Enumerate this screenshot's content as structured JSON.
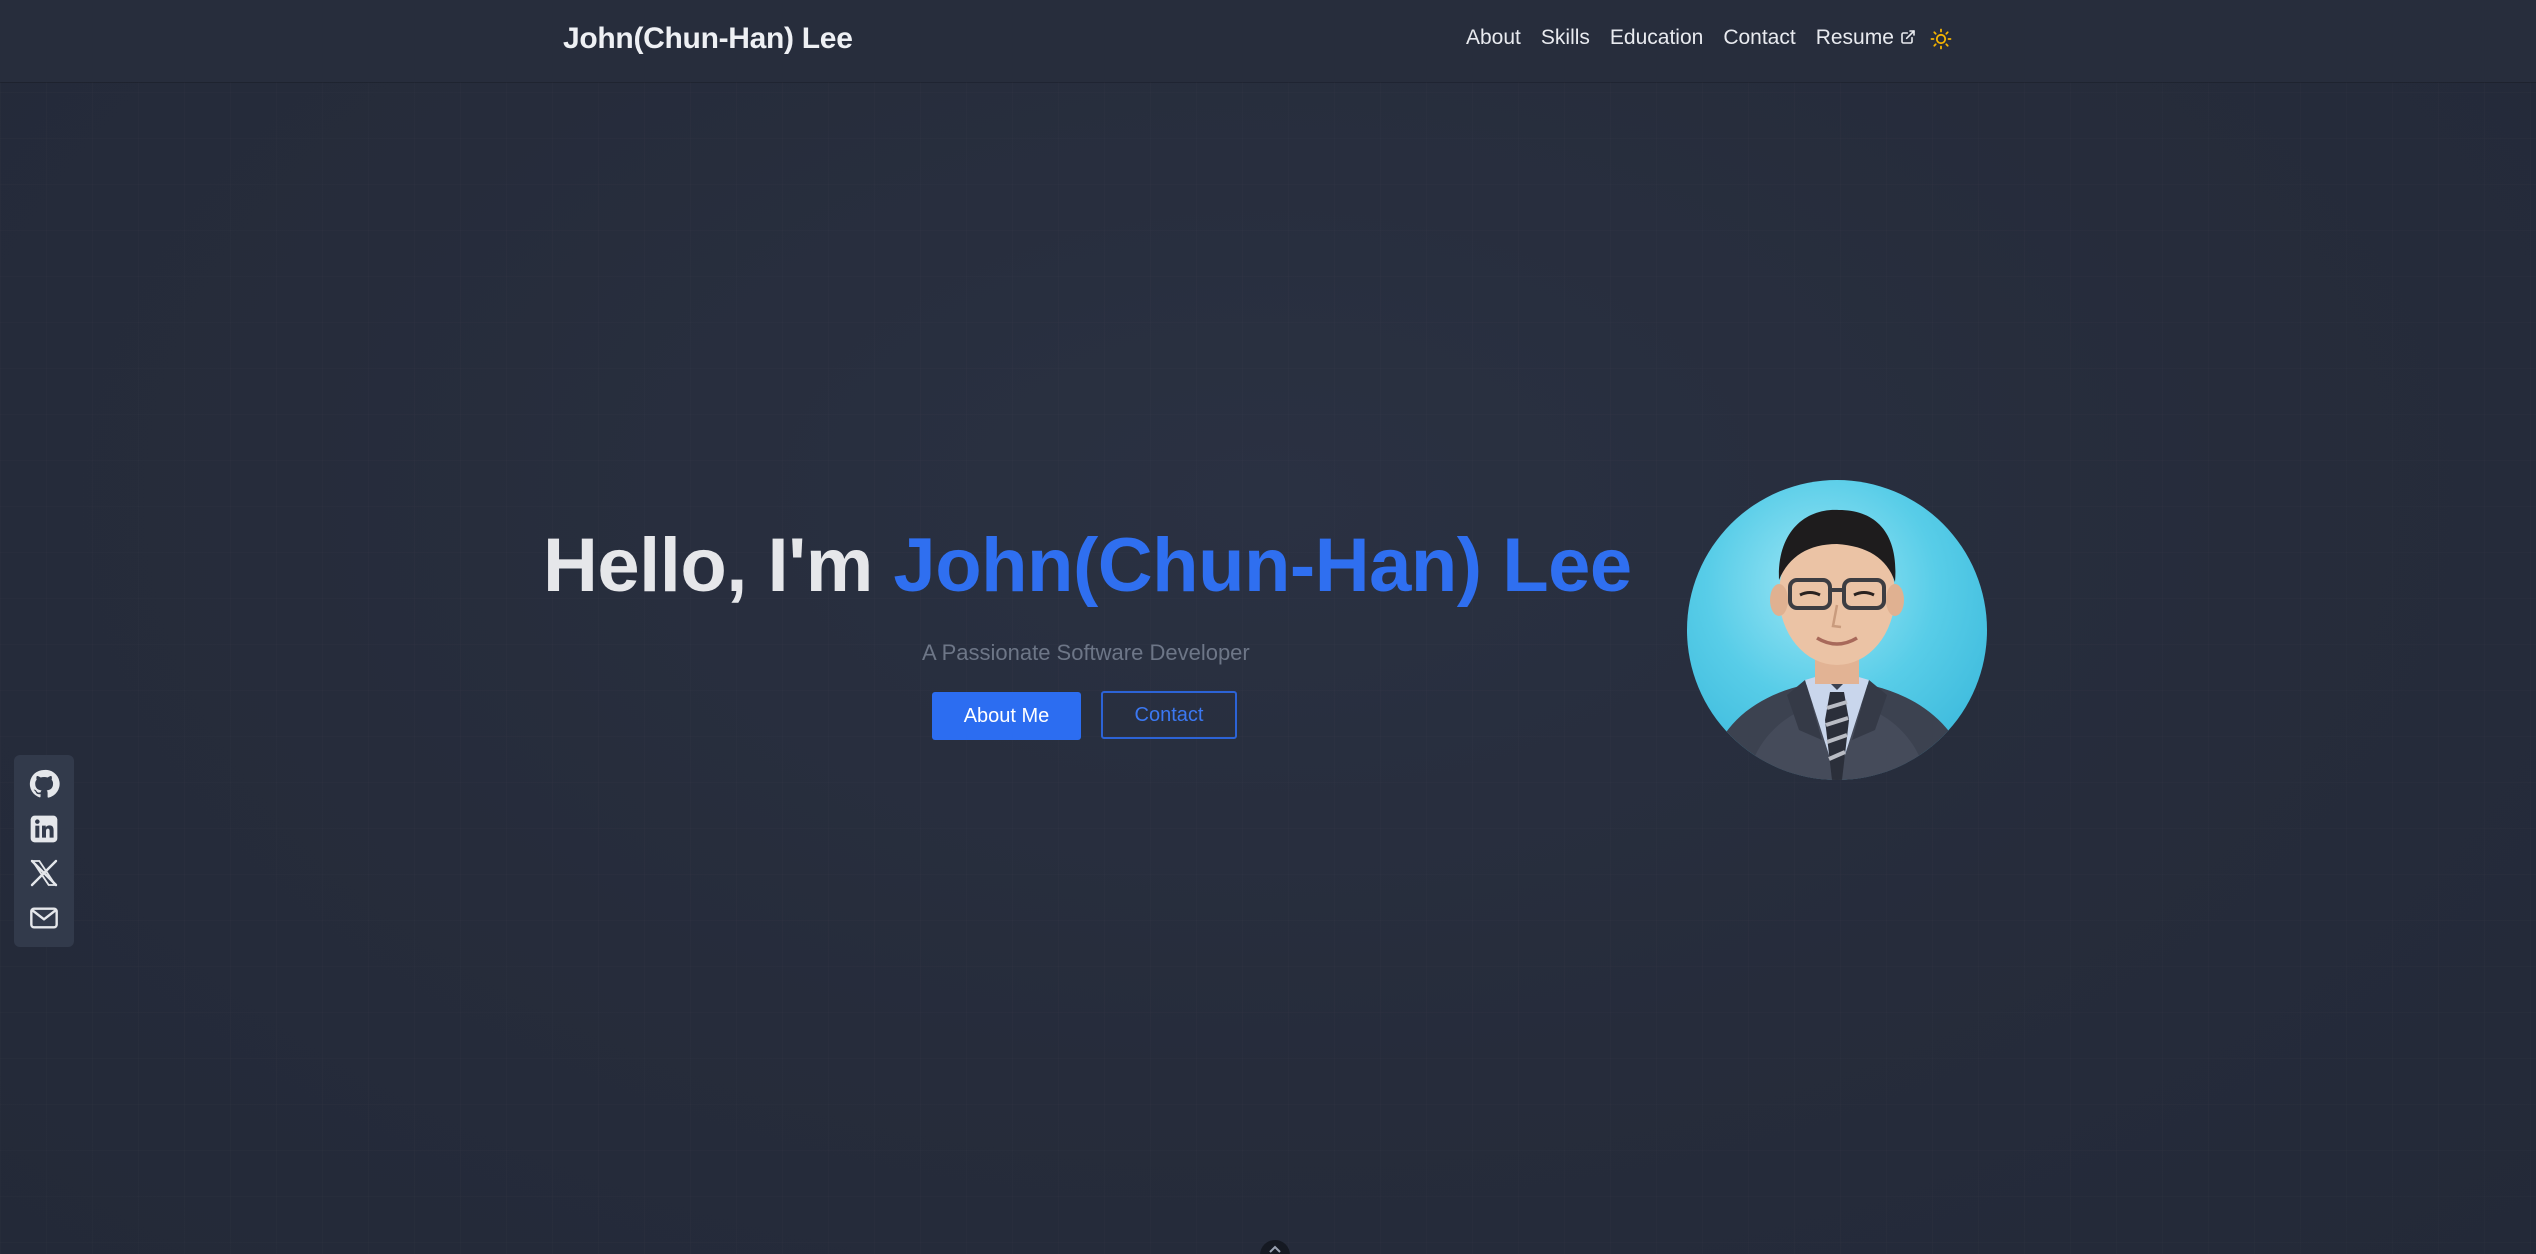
{
  "header": {
    "brand": "John(Chun-Han) Lee",
    "nav": [
      {
        "label": "About"
      },
      {
        "label": "Skills"
      },
      {
        "label": "Education"
      },
      {
        "label": "Contact"
      },
      {
        "label": "Resume",
        "icon": "external-link-icon"
      }
    ],
    "theme_toggle_icon": "sun-icon"
  },
  "hero": {
    "greeting": "Hello, I'm ",
    "name": "John(Chun-Han) Lee",
    "subtitle": "A Passionate Software Developer",
    "primary_button": "About Me",
    "secondary_button": "Contact",
    "avatar": "profile-photo"
  },
  "social": [
    "github-icon",
    "linkedin-icon",
    "x-twitter-icon",
    "email-icon"
  ],
  "colors": {
    "background": "#262c3b",
    "accent": "#2f6ff0",
    "sun": "#f5b400"
  }
}
